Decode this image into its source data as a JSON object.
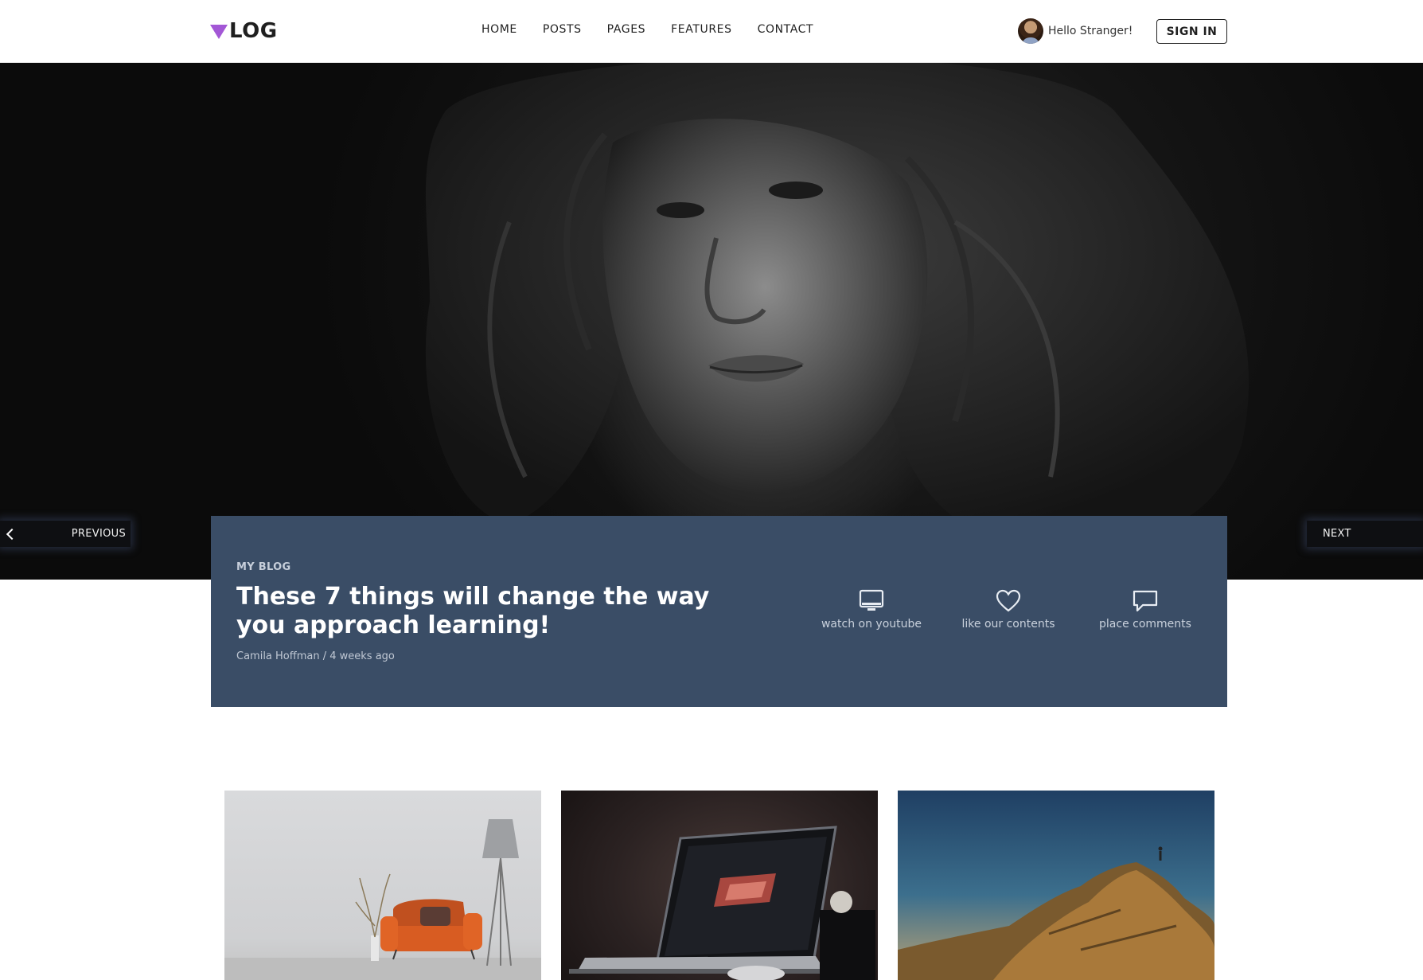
{
  "header": {
    "logo_text": "LOG",
    "nav": [
      "HOME",
      "POSTS",
      "PAGES",
      "FEATURES",
      "CONTACT"
    ],
    "greeting": "Hello Stranger!",
    "signin_label": "SIGN IN"
  },
  "slider": {
    "prev_label": "PREVIOUS",
    "next_label": "NEXT"
  },
  "post": {
    "category": "MY BLOG",
    "title": "These 7 things will change the way you approach learning!",
    "meta": "Camila Hoffman / 4 weeks ago",
    "actions": [
      {
        "label": "watch on youtube",
        "icon": "monitor-icon"
      },
      {
        "label": "like our contents",
        "icon": "heart-icon"
      },
      {
        "label": "place comments",
        "icon": "comment-icon"
      }
    ]
  },
  "colors": {
    "accent": "#a357d6",
    "card_bg": "#3a4d66"
  }
}
